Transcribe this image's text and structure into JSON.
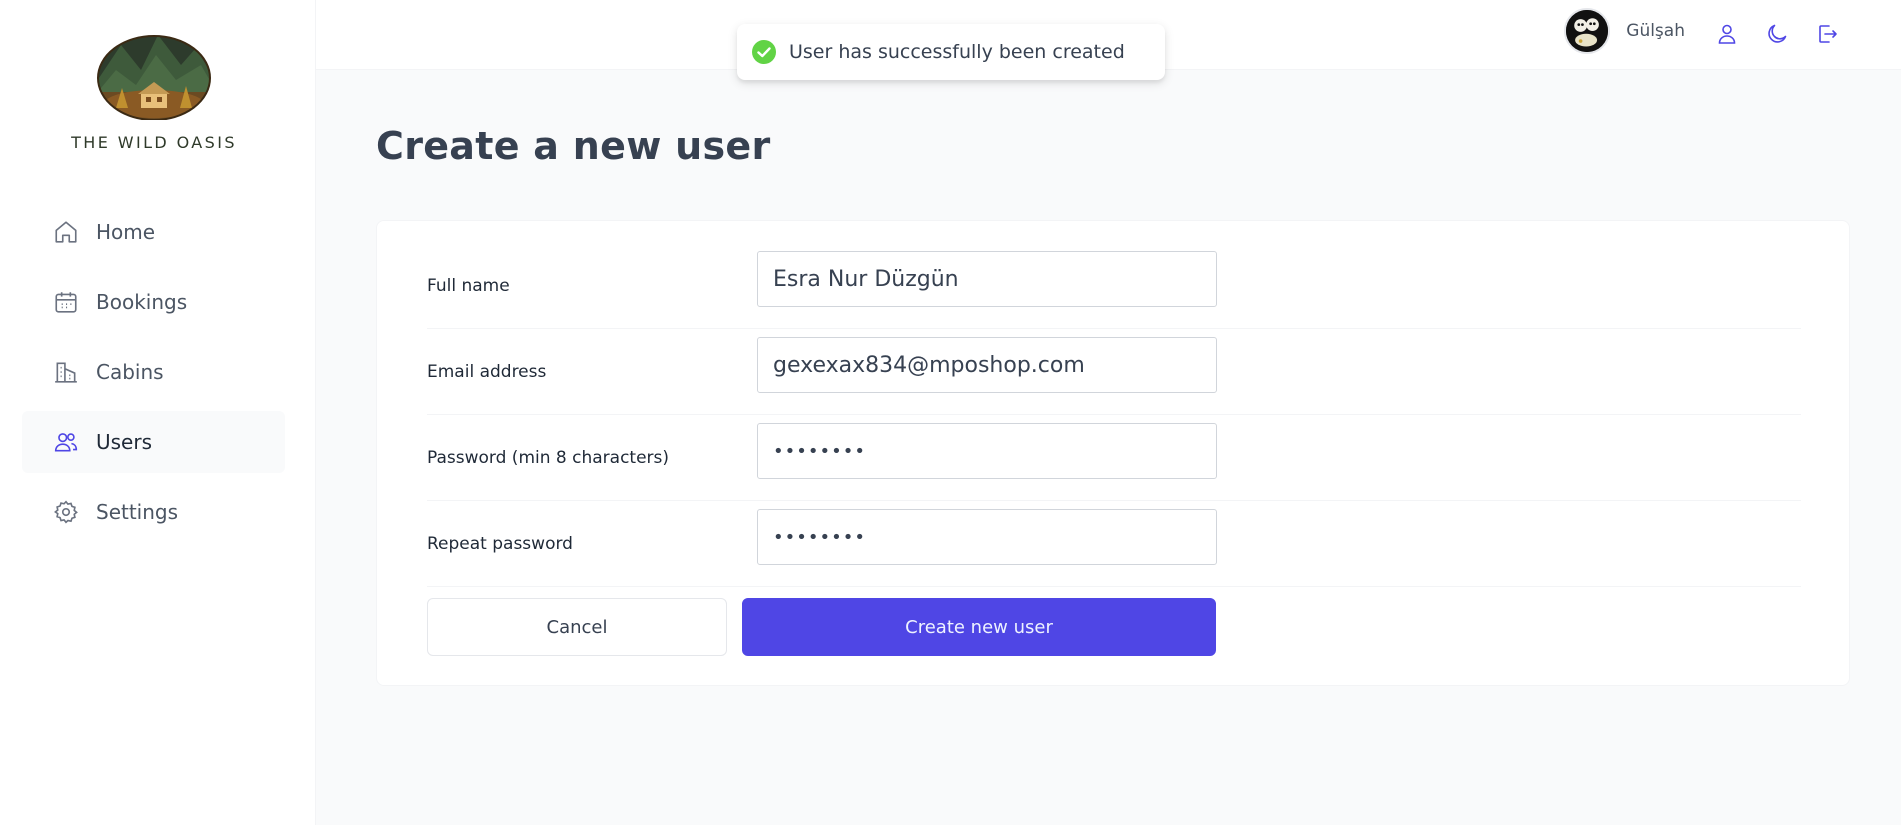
{
  "brand": {
    "name": "THE WILD OASIS"
  },
  "sidebar": {
    "items": [
      {
        "label": "Home",
        "icon": "home-icon",
        "active": false
      },
      {
        "label": "Bookings",
        "icon": "calendar-icon",
        "active": false
      },
      {
        "label": "Cabins",
        "icon": "buildings-icon",
        "active": false
      },
      {
        "label": "Users",
        "icon": "users-icon",
        "active": true
      },
      {
        "label": "Settings",
        "icon": "gear-icon",
        "active": false
      }
    ]
  },
  "header": {
    "user_name": "Gülşah",
    "icons": [
      "user-icon",
      "moon-icon",
      "logout-icon"
    ]
  },
  "toast": {
    "message": "User has successfully been created",
    "icon": "check-circle-icon",
    "color": "#61d345"
  },
  "page": {
    "title": "Create a new user"
  },
  "form": {
    "full_name": {
      "label": "Full name",
      "value": "Esra Nur Düzgün"
    },
    "email": {
      "label": "Email address",
      "value": "gexexax834@mposhop.com"
    },
    "password": {
      "label": "Password (min 8 characters)",
      "value": "••••••••"
    },
    "repeat_password": {
      "label": "Repeat password",
      "value": "••••••••"
    },
    "cancel_label": "Cancel",
    "submit_label": "Create new user"
  },
  "colors": {
    "accent": "#4f46e5",
    "nav_icon": "#6b7280",
    "active_icon": "#4f46e5"
  }
}
